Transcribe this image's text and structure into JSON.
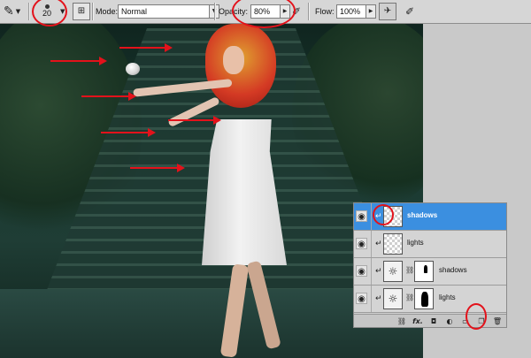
{
  "options_bar": {
    "brush_tool_icon": "brush-icon",
    "brush_size": "20",
    "mode_label": "Mode:",
    "mode_value": "Normal",
    "opacity_label": "Opacity:",
    "opacity_value": "80%",
    "flow_label": "Flow:",
    "flow_value": "100%"
  },
  "layers_panel": {
    "layers": [
      {
        "name": "shadows",
        "selected": true,
        "kind": "pixel",
        "clipped": true
      },
      {
        "name": "lights",
        "selected": false,
        "kind": "pixel",
        "clipped": true
      },
      {
        "name": "shadows",
        "selected": false,
        "kind": "adjustment",
        "clipped": true
      },
      {
        "name": "lights",
        "selected": false,
        "kind": "adjustment",
        "clipped": true
      }
    ],
    "footer_fx_label": "fx."
  },
  "colors": {
    "annotation_red": "#e3121b",
    "selection_blue": "#3b8fe0"
  }
}
